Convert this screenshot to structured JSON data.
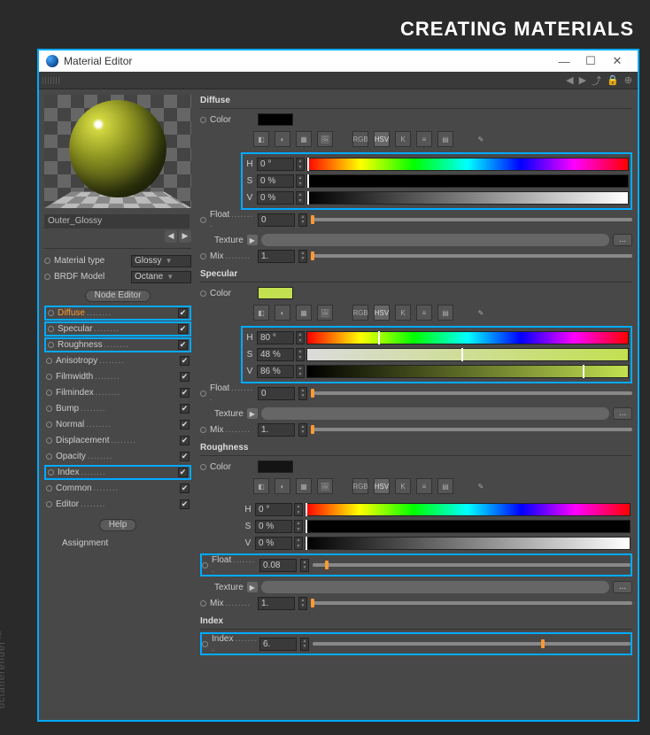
{
  "page_title": "CREATING MATERIALS",
  "window": {
    "title": "Material Editor"
  },
  "material": {
    "name": "Outer_Glossy",
    "type_label": "Material type",
    "type_value": "Glossy",
    "brdf_label": "BRDF Model",
    "brdf_value": "Octane"
  },
  "buttons": {
    "node_editor": "Node Editor",
    "help": "Help"
  },
  "channels": [
    {
      "label": "Diffuse",
      "checked": true,
      "active": true,
      "hl": true
    },
    {
      "label": "Specular",
      "checked": true,
      "active": false,
      "hl": true
    },
    {
      "label": "Roughness",
      "checked": true,
      "active": false,
      "hl": true
    },
    {
      "label": "Anisotropy",
      "checked": true,
      "active": false,
      "hl": false
    },
    {
      "label": "Filmwidth",
      "checked": true,
      "active": false,
      "hl": false
    },
    {
      "label": "Filmindex",
      "checked": true,
      "active": false,
      "hl": false
    },
    {
      "label": "Bump",
      "checked": true,
      "active": false,
      "hl": false
    },
    {
      "label": "Normal",
      "checked": true,
      "active": false,
      "hl": false
    },
    {
      "label": "Displacement",
      "checked": true,
      "active": false,
      "hl": false
    },
    {
      "label": "Opacity",
      "checked": true,
      "active": false,
      "hl": false
    },
    {
      "label": "Index",
      "checked": true,
      "active": false,
      "hl": true
    },
    {
      "label": "Common",
      "checked": true,
      "active": false,
      "hl": false
    },
    {
      "label": "Editor",
      "checked": true,
      "active": false,
      "hl": false
    }
  ],
  "assignment_label": "Assignment",
  "labels": {
    "color": "Color",
    "float": "Float",
    "texture": "Texture",
    "mix": "Mix",
    "index": "Index",
    "h": "H",
    "s": "S",
    "v": "V",
    "rgb": "RGB",
    "hsv": "HSV",
    "k": "K"
  },
  "sections": {
    "diffuse": {
      "title": "Diffuse",
      "color": "#000000",
      "h": "0 °",
      "s": "0 %",
      "v": "0 %",
      "float": "0",
      "mix": "1."
    },
    "specular": {
      "title": "Specular",
      "color": "#c2e050",
      "h": "80 °",
      "s": "48 %",
      "v": "86 %",
      "float": "0",
      "mix": "1."
    },
    "roughness": {
      "title": "Roughness",
      "color": "#141414",
      "h": "0 °",
      "s": "0 %",
      "v": "0 %",
      "float": "0.08",
      "mix": "1."
    },
    "index": {
      "title": "Index",
      "value": "6."
    }
  },
  "watermark": "octanerender™"
}
